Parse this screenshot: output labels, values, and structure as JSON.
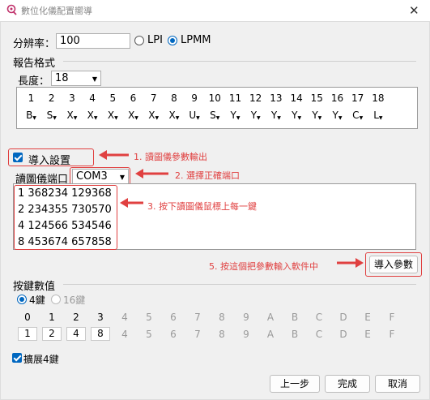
{
  "window": {
    "title": "數位化儀配置嚮導",
    "close_glyph": "✕"
  },
  "resolution": {
    "label": "分辨率：",
    "value": "100",
    "options": [
      "LPI",
      "LPMM"
    ],
    "selected": "LPMM"
  },
  "report_format": {
    "group_label": "報告格式",
    "length_label": "長度：",
    "length_value": "18",
    "columns": [
      "1",
      "2",
      "3",
      "4",
      "5",
      "6",
      "7",
      "8",
      "9",
      "10",
      "11",
      "12",
      "13",
      "14",
      "15",
      "16",
      "17",
      "18"
    ],
    "values": [
      "B",
      "S",
      "X",
      "X",
      "X",
      "X",
      "X",
      "X",
      "U",
      "S",
      "Y",
      "Y",
      "Y",
      "Y",
      "Y",
      "Y",
      "C",
      "L"
    ]
  },
  "import_settings": {
    "label": "導入設置",
    "checked": true
  },
  "port": {
    "label": "讀圖儀端口",
    "value": "COM3"
  },
  "reading_lines": [
    "1 368234 129368",
    "2 234355 730570",
    "4 124566 534546",
    "8 453674 657858"
  ],
  "annotations": {
    "a1": "1. 讀圖儀參數輸出",
    "a2": "2. 選擇正確端口",
    "a3": "3. 按下讀圖儀鼠標上每一鍵",
    "a5": "5. 按這個把參數輸入軟件中"
  },
  "import_params_button": "導入參數",
  "keys": {
    "group_label": "按鍵數值",
    "mode_options": [
      "4鍵",
      "16鍵"
    ],
    "mode_selected": "4鍵",
    "headers": [
      "0",
      "1",
      "2",
      "3",
      "4",
      "5",
      "6",
      "7",
      "8",
      "9",
      "A",
      "B",
      "C",
      "D",
      "E",
      "F"
    ],
    "values": [
      "1",
      "2",
      "4",
      "8",
      "4",
      "5",
      "6",
      "7",
      "8",
      "9",
      "A",
      "B",
      "C",
      "D",
      "E",
      "F"
    ],
    "extend_label": "擴展4鍵",
    "extend_checked": true
  },
  "buttons": {
    "prev": "上一步",
    "finish": "完成",
    "cancel": "取消"
  },
  "colors": {
    "accent": "#0067c0",
    "annotation": "#e04040"
  }
}
